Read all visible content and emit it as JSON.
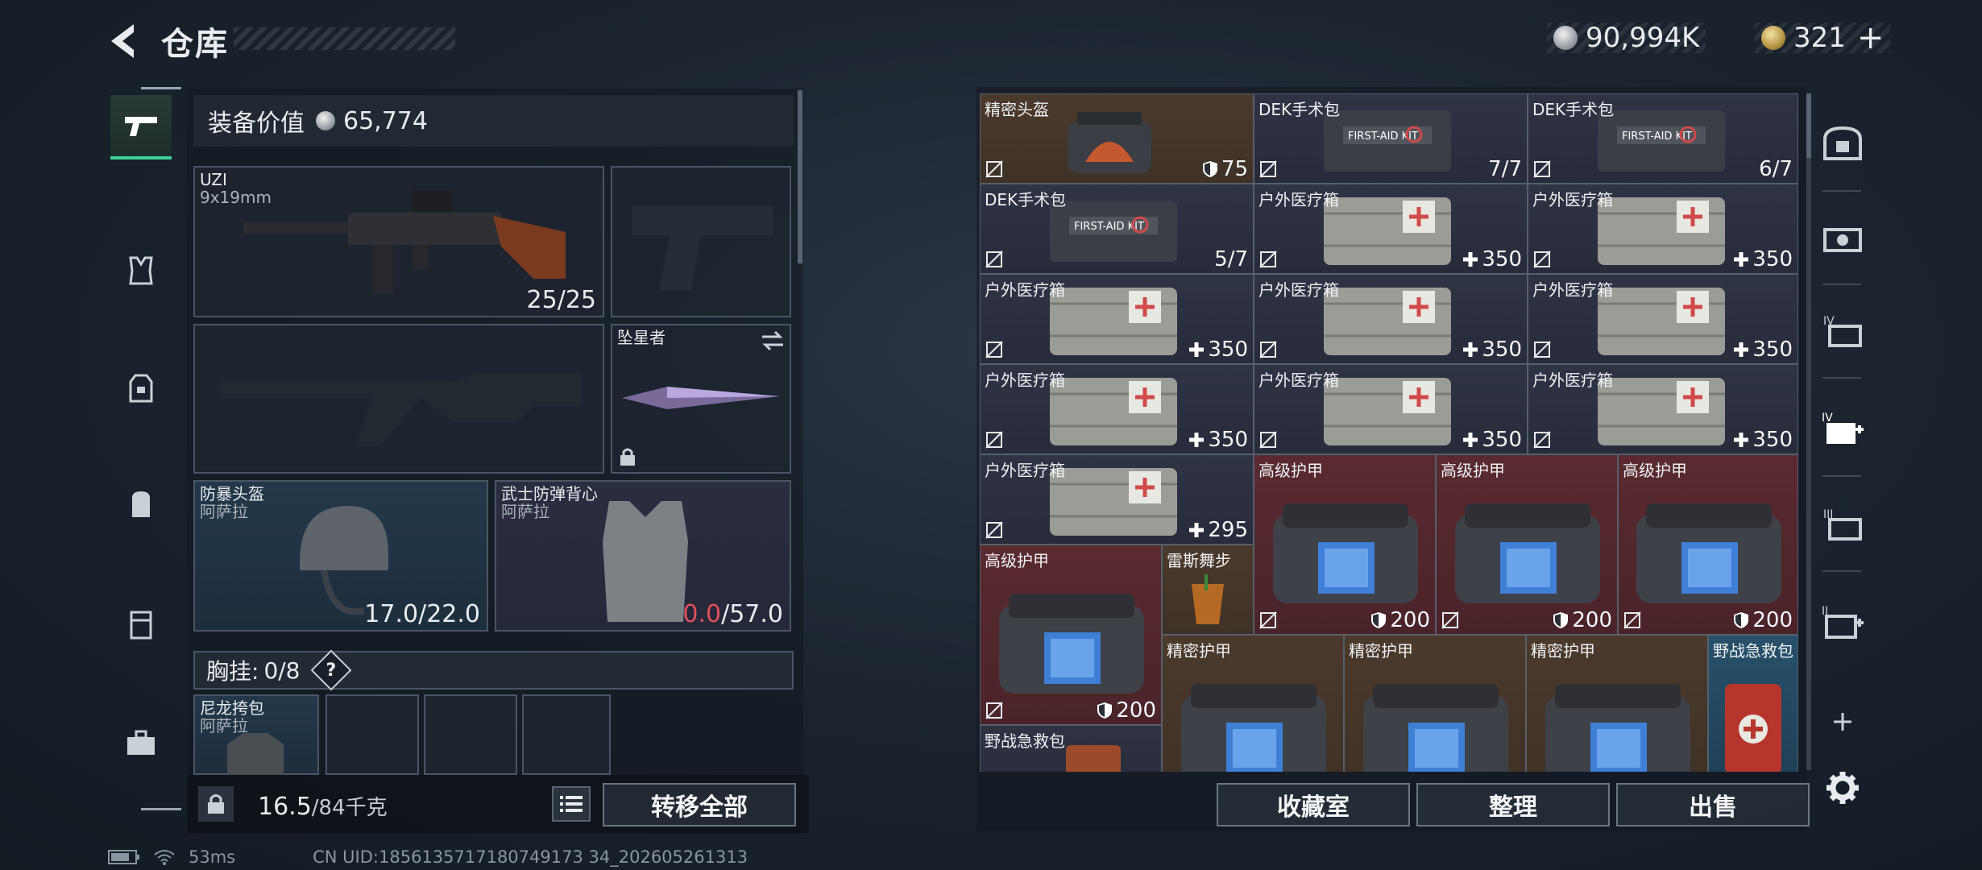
{
  "header": {
    "title": "仓库",
    "silver": "90,994K",
    "gold": "321"
  },
  "sidebar": {
    "items": [
      "weapon-icon",
      "vest-icon",
      "armor-icon",
      "backpack-icon",
      "locker-icon",
      "toolbox-icon"
    ]
  },
  "equipment": {
    "label": "装备价值",
    "value": "65,774",
    "primary": {
      "name": "UZI",
      "caliber": "9x19mm",
      "ammo": "25/25"
    },
    "melee": {
      "name": "坠星者"
    },
    "helmet": {
      "name": "防暴头盔",
      "maker": "阿萨拉",
      "cur": "17.0",
      "max": "/22.0"
    },
    "vest": {
      "name": "武士防弹背心",
      "maker": "阿萨拉",
      "cur": "0.0",
      "max": "/57.0"
    },
    "chest": {
      "label": "胸挂:",
      "count": "0/8",
      "help": "?"
    },
    "pouch": {
      "name": "尼龙挎包",
      "maker": "阿萨拉"
    }
  },
  "bottom": {
    "weight": "16.5",
    "capacity": "/84千克",
    "transfer": "转移全部"
  },
  "storage": {
    "items": [
      {
        "name": "精密头盔",
        "count": "75",
        "kind": "shield"
      },
      {
        "name": "DEK手术包",
        "count": "7/7",
        "kind": "none"
      },
      {
        "name": "DEK手术包",
        "count": "6/7",
        "kind": "none"
      },
      {
        "name": "DEK手术包",
        "count": "5/7",
        "kind": "none"
      },
      {
        "name": "户外医疗箱",
        "count": "350",
        "kind": "plus"
      },
      {
        "name": "户外医疗箱",
        "count": "350",
        "kind": "plus"
      },
      {
        "name": "户外医疗箱",
        "count": "350",
        "kind": "plus"
      },
      {
        "name": "户外医疗箱",
        "count": "350",
        "kind": "plus"
      },
      {
        "name": "户外医疗箱",
        "count": "350",
        "kind": "plus"
      },
      {
        "name": "户外医疗箱",
        "count": "350",
        "kind": "plus"
      },
      {
        "name": "户外医疗箱",
        "count": "350",
        "kind": "plus"
      },
      {
        "name": "户外医疗箱",
        "count": "350",
        "kind": "plus"
      },
      {
        "name": "户外医疗箱",
        "count": "295",
        "kind": "plus"
      },
      {
        "name": "高级护甲",
        "count": "200",
        "kind": "shield"
      },
      {
        "name": "高级护甲",
        "count": "200",
        "kind": "shield"
      },
      {
        "name": "高级护甲",
        "count": "200",
        "kind": "shield"
      },
      {
        "name": "高级护甲",
        "count": "200",
        "kind": "shield"
      },
      {
        "name": "雷斯舞步",
        "count": "",
        "kind": "none"
      },
      {
        "name": "精密护甲",
        "count": "",
        "kind": "none"
      },
      {
        "name": "精密护甲",
        "count": "",
        "kind": "none"
      },
      {
        "name": "精密护甲",
        "count": "",
        "kind": "none"
      },
      {
        "name": "野战急救包",
        "count": "",
        "kind": "none"
      },
      {
        "name": "野战急救包",
        "count": "",
        "kind": "none"
      }
    ],
    "buttons": {
      "collection": "收藏室",
      "sort": "整理",
      "sell": "出售"
    }
  },
  "right_tabs": [
    "armor-tab",
    "vehicle-tab",
    "tier4-tab",
    "tier4-med-tab",
    "tier3-tab",
    "tier2-med-tab"
  ],
  "status": {
    "ping": "53ms",
    "uid": "CN UID:1856135717180749173 34_202605261313"
  },
  "colors": {
    "accent": "#3ed19a",
    "red_value": "#e0505a",
    "cell_red": "#5a2a30",
    "cell_brown": "#4b3a2c"
  }
}
